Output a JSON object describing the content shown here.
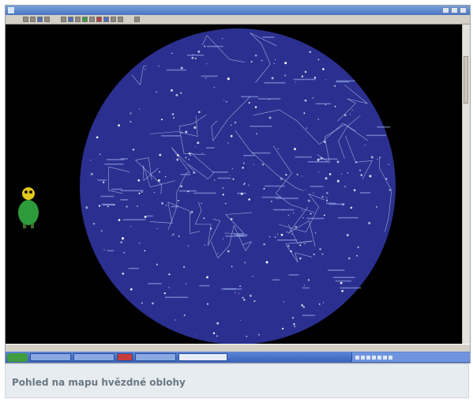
{
  "caption": {
    "text": "Pohled na mapu hvězdné oblohy"
  },
  "colors": {
    "sky_disc": "#2b2f8f",
    "sky_background": "#000000",
    "constellation_lines": "#c7d3f5",
    "mascot": "#2e9b3b",
    "caption_background": "#e7ecf0",
    "caption_text": "#6b7883"
  },
  "icons": {
    "mascot": "green-alien-mascot-icon",
    "start_button": "start-button",
    "window_controls": [
      "minimize-icon",
      "maximize-icon",
      "close-icon"
    ]
  }
}
